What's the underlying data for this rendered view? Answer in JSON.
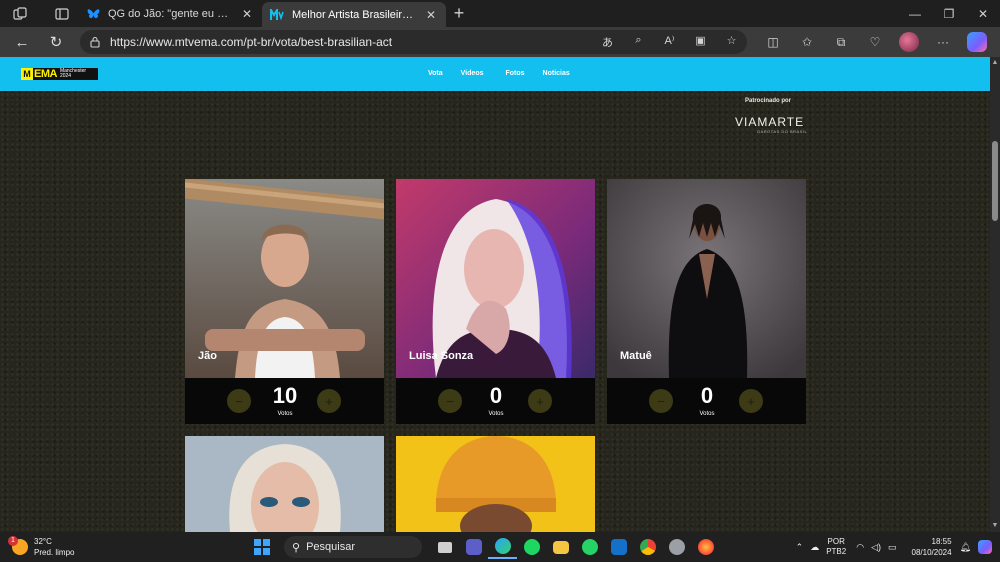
{
  "browser": {
    "tabs": [
      {
        "title": "QG do Jão: \"gente eu abri essa co",
        "active": false
      },
      {
        "title": "Melhor Artista Brasileiro - Vote N",
        "active": true
      }
    ],
    "url": "https://www.mtvema.com/pt-br/vota/best-brasilian-act"
  },
  "site": {
    "logo": {
      "brand": "EMA",
      "city": "Manchester",
      "year": "2024",
      "m": "M"
    },
    "nav": [
      "Vota",
      "Videos",
      "Fotos",
      "Noticias"
    ],
    "sponsor": {
      "label": "Patrocinado por",
      "logo": "VIAMARTE",
      "sub": "GAROTAS DO BRASIL"
    }
  },
  "candidates": [
    {
      "name": "Jão",
      "votes": "10",
      "votes_label": "Votos"
    },
    {
      "name": "Luisa Sonza",
      "votes": "0",
      "votes_label": "Votos"
    },
    {
      "name": "Matuê",
      "votes": "0",
      "votes_label": "Votos"
    }
  ],
  "controls": {
    "minus": "−",
    "plus": "+"
  },
  "taskbar": {
    "weather": {
      "temp": "32°C",
      "desc": "Pred. limpo",
      "badge": "1"
    },
    "search_placeholder": "Pesquisar",
    "lang": {
      "line1": "POR",
      "line2": "PTB2"
    },
    "time": "18:55",
    "date": "08/10/2024"
  },
  "colors": {
    "header": "#13bfee",
    "logo_yellow": "#fff200",
    "vote_button": "#3d3a16"
  }
}
